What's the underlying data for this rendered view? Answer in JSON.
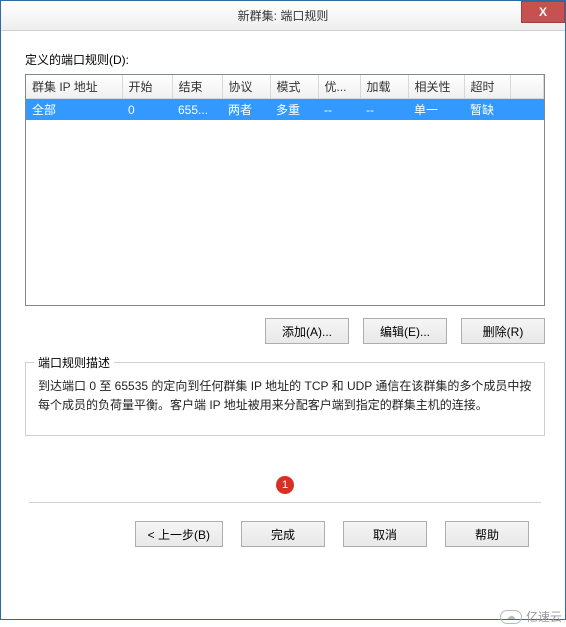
{
  "window": {
    "title": "新群集: 端口规则",
    "close": "X"
  },
  "labels": {
    "defined_rules": "定义的端口规则(D):",
    "groupbox_title": "端口规则描述",
    "description": "到达端口 0 至 65535 的定向到任何群集 IP 地址的 TCP 和 UDP 通信在该群集的多个成员中按每个成员的负荷量平衡。客户端 IP 地址被用来分配客户端到指定的群集主机的连接。"
  },
  "table": {
    "headers": {
      "cluster_ip": "群集 IP 地址",
      "start": "开始",
      "end": "结束",
      "protocol": "协议",
      "mode": "模式",
      "priority": "优...",
      "load": "加载",
      "affinity": "相关性",
      "timeout": "超时"
    },
    "rows": [
      {
        "cluster_ip": "全部",
        "start": "0",
        "end": "655...",
        "protocol": "两者",
        "mode": "多重",
        "priority": "--",
        "load": "--",
        "affinity": "单一",
        "timeout": "暂缺"
      }
    ]
  },
  "buttons": {
    "add": "添加(A)...",
    "edit": "编辑(E)...",
    "remove": "删除(R)",
    "back": "< 上一步(B)",
    "finish": "完成",
    "cancel": "取消",
    "help": "帮助"
  },
  "annotation": {
    "step": "1"
  },
  "watermark": {
    "text": "亿速云"
  }
}
